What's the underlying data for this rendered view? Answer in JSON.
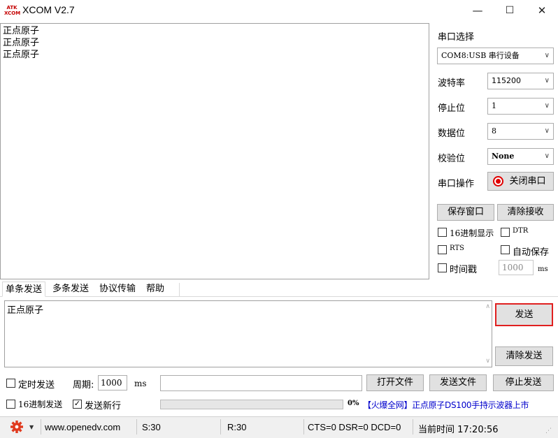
{
  "window": {
    "title": "XCOM V2.7",
    "logo_line1": "ATK",
    "logo_line2": "XCOM",
    "minimize": "—",
    "maximize": "☐",
    "close": "✕"
  },
  "receive": {
    "text": "正点原子\n正点原子\n正点原子"
  },
  "serial": {
    "section_title": "串口选择",
    "port": "COM8:USB 串行设备",
    "baud_label": "波特率",
    "baud": "115200",
    "stop_label": "停止位",
    "stop": "1",
    "data_label": "数据位",
    "data": "8",
    "parity_label": "校验位",
    "parity": "None",
    "operate_label": "串口操作",
    "operate_button": "关闭串口",
    "status_color": "#e00000"
  },
  "receive_options": {
    "save_window": "保存窗口",
    "clear_receive": "清除接收",
    "hex_display": "16进制显示",
    "dtr": "DTR",
    "rts": "RTS",
    "auto_save": "自动保存",
    "timestamp": "时间戳",
    "timestamp_interval": "1000",
    "ms_unit": "ms"
  },
  "tabs": [
    "单条发送",
    "多条发送",
    "协议传输",
    "帮助"
  ],
  "send": {
    "text": "正点原子",
    "send_button": "发送",
    "clear_send": "清除发送",
    "timed_send": "定时发送",
    "period_label": "周期:",
    "period": "1000",
    "ms_unit": "ms",
    "open_file": "打开文件",
    "send_file": "发送文件",
    "stop_send": "停止发送",
    "hex_send": "16进制发送",
    "send_newline": "发送新行",
    "progress": "0%",
    "progress_value": 0,
    "ad_text": "【火爆全网】正点原子DS100手持示波器上市",
    "highlight_color": "#e02020",
    "ad_color": "#0000cc"
  },
  "status": {
    "website": "www.openedv.com",
    "sent": "S:30",
    "received": "R:30",
    "lines": "CTS=0 DSR=0 DCD=0",
    "time": "当前时间 17:20:56",
    "gear_color": "#e03a1e"
  }
}
